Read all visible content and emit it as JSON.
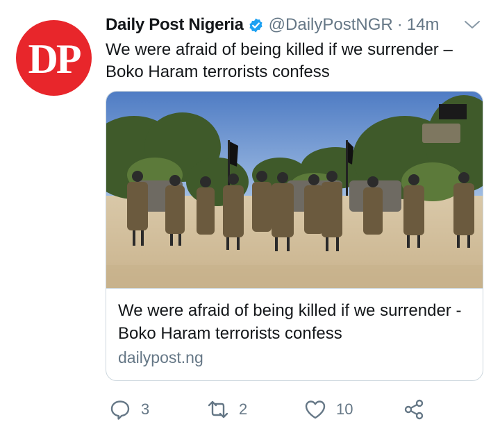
{
  "avatar": {
    "initials": "DP",
    "color": "#e8262b"
  },
  "header": {
    "name": "Daily Post Nigeria",
    "handle": "@DailyPostNGR",
    "separator": "·",
    "time": "14m"
  },
  "tweet": {
    "text_line1": "We were afraid of being killed if we surrender –",
    "text_line2": "Boko Haram terrorists confess"
  },
  "card": {
    "title_line1": "We were afraid of being killed if we surrender -",
    "title_line2": "Boko Haram terrorists confess",
    "domain": "dailypost.ng"
  },
  "actions": {
    "reply_count": "3",
    "retweet_count": "2",
    "like_count": "10"
  },
  "icons": {
    "verified": "verified-badge-icon",
    "more": "chevron-down-icon",
    "reply": "reply-icon",
    "retweet": "retweet-icon",
    "like": "heart-icon",
    "share": "share-icon"
  },
  "colors": {
    "text": "#14171a",
    "secondary": "#657786",
    "verified": "#1da1f2",
    "border": "#ccd6dd"
  }
}
